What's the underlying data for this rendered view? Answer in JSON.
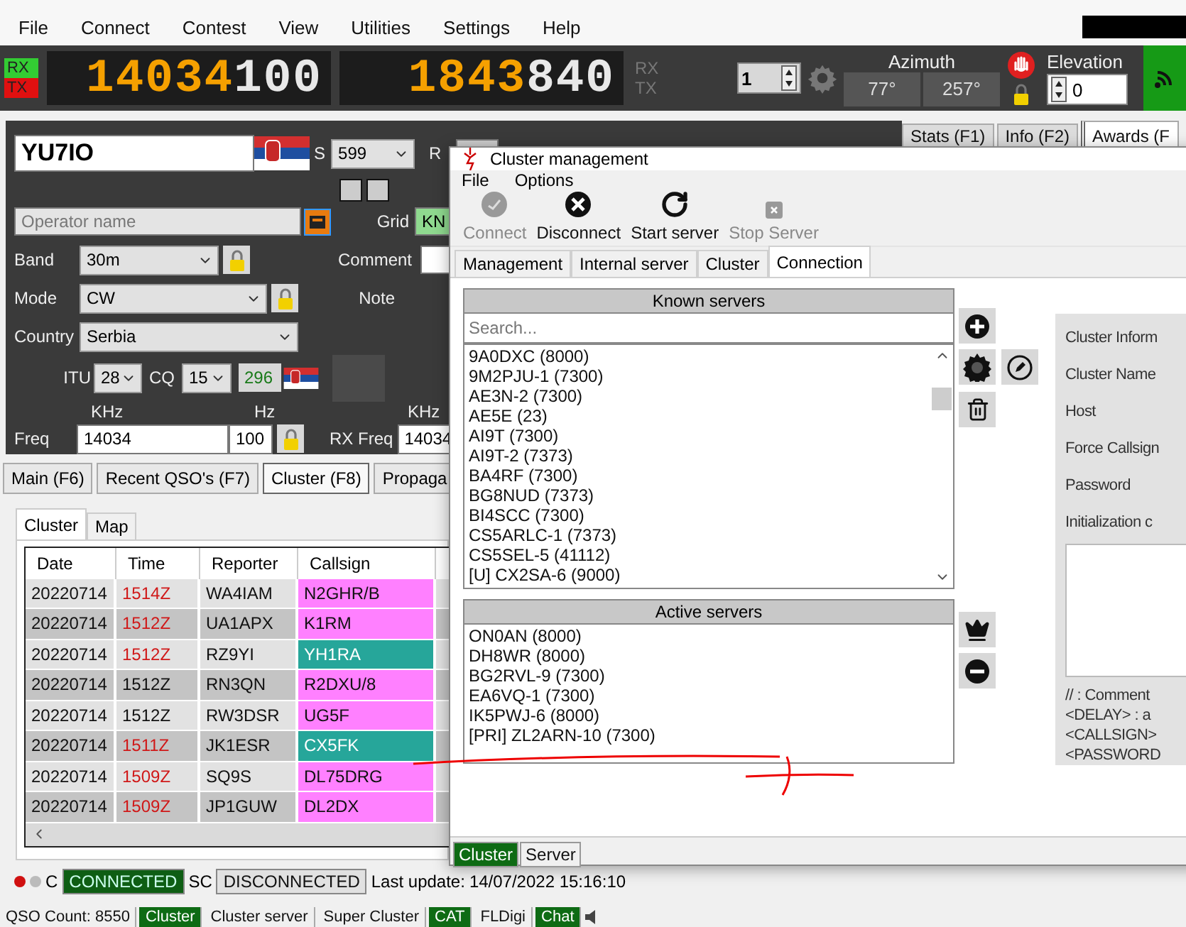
{
  "menu": [
    "File",
    "Connect",
    "Contest",
    "View",
    "Utilities",
    "Settings",
    "Help"
  ],
  "vfo": {
    "rx": "RX",
    "tx": "TX",
    "freq_main": "14034",
    "freq_sub": "100",
    "freq2_main": "1843",
    "freq2_sub": "840",
    "side_rx": "RX",
    "side_tx": "TX"
  },
  "rotator": {
    "spin": "1",
    "azimuth_label": "Azimuth",
    "azimuth_values": [
      "77°",
      "257°"
    ],
    "elevation_label": "Elevation",
    "elevation": "0"
  },
  "side_tabs": [
    {
      "label": "Stats (F1)",
      "selected": false
    },
    {
      "label": "Info (F2)",
      "selected": false
    },
    {
      "label": "Awards (F",
      "selected": true
    }
  ],
  "entry": {
    "callsign": "YU7IO",
    "s_label": "S",
    "rst_sent": "599",
    "r_label": "R",
    "operator_placeholder": "Operator name",
    "grid_label": "Grid",
    "grid": "KN",
    "band_label": "Band",
    "band": "30m",
    "comment_label": "Comment",
    "mode_label": "Mode",
    "mode": "CW",
    "note_label": "Note",
    "country_label": "Country",
    "country": "Serbia",
    "itu_label": "ITU",
    "itu": "28",
    "cq_label": "CQ",
    "cq": "15",
    "dxcc": "296",
    "khz_label": "KHz",
    "hz_label": "Hz",
    "rx_khz_label": "KHz",
    "freq_label": "Freq",
    "freq_khz": "14034",
    "freq_hz": "100",
    "rx_freq_label": "RX Freq",
    "rx_freq": "14034"
  },
  "main_tabs": [
    {
      "label": "Main (F6)",
      "selected": false
    },
    {
      "label": "Recent QSO's (F7)",
      "selected": false
    },
    {
      "label": "Cluster (F8)",
      "selected": true
    },
    {
      "label": "Propaga",
      "selected": false
    }
  ],
  "inner_tabs": [
    {
      "label": "Cluster",
      "selected": true
    },
    {
      "label": "Map",
      "selected": false
    }
  ],
  "table": {
    "columns": [
      "Date",
      "Time",
      "Reporter",
      "Callsign"
    ],
    "rows": [
      {
        "date": "20220714",
        "time": "1514Z",
        "recent": true,
        "reporter": "WA4IAM",
        "callsign": "N2GHR/B",
        "color": "#ff80ff"
      },
      {
        "date": "20220714",
        "time": "1512Z",
        "recent": true,
        "reporter": "UA1APX",
        "callsign": "K1RM",
        "color": "#ff80ff"
      },
      {
        "date": "20220714",
        "time": "1512Z",
        "recent": true,
        "reporter": "RZ9YI",
        "callsign": "YH1RA",
        "color": "#26a69a"
      },
      {
        "date": "20220714",
        "time": "1512Z",
        "recent": false,
        "reporter": "RN3QN",
        "callsign": "R2DXU/8",
        "color": "#ff80ff"
      },
      {
        "date": "20220714",
        "time": "1512Z",
        "recent": false,
        "reporter": "RW3DSR",
        "callsign": "UG5F",
        "color": "#ff80ff"
      },
      {
        "date": "20220714",
        "time": "1511Z",
        "recent": true,
        "reporter": "JK1ESR",
        "callsign": "CX5FK",
        "color": "#26a69a"
      },
      {
        "date": "20220714",
        "time": "1509Z",
        "recent": true,
        "reporter": "SQ9S",
        "callsign": "DL75DRG",
        "color": "#ff80ff"
      },
      {
        "date": "20220714",
        "time": "1509Z",
        "recent": true,
        "reporter": "JP1GUW",
        "callsign": "DL2DX",
        "color": "#ff80ff"
      }
    ]
  },
  "status": {
    "c_label": "C",
    "c_status": "CONNECTED",
    "c_connected": true,
    "sc_label": "SC",
    "sc_status": "DISCONNECTED",
    "sc_connected": false,
    "last_update_label": "Last update:",
    "last_update": "14/07/2022 15:16:10"
  },
  "bottom_bar": [
    {
      "label": "QSO Count: 8550",
      "active": false
    },
    {
      "label": "Cluster",
      "active": true
    },
    {
      "label": "Cluster server",
      "active": false
    },
    {
      "label": "Super Cluster",
      "active": false
    },
    {
      "label": "CAT",
      "active": true
    },
    {
      "label": "FLDigi",
      "active": false
    },
    {
      "label": "Chat",
      "active": true
    }
  ],
  "dialog": {
    "title": "Cluster management",
    "menu": [
      "File",
      "Options"
    ],
    "toolbar": [
      {
        "kind": "connect",
        "label": "Connect",
        "disabled": true
      },
      {
        "kind": "disconnect",
        "label": "Disconnect",
        "disabled": false
      },
      {
        "kind": "start",
        "label": "Start server",
        "disabled": false
      },
      {
        "kind": "stop",
        "label": "Stop Server",
        "disabled": true
      }
    ],
    "tabs": [
      {
        "label": "Management",
        "selected": false
      },
      {
        "label": "Internal server",
        "selected": false
      },
      {
        "label": "Cluster",
        "selected": false
      },
      {
        "label": "Connection",
        "selected": true
      }
    ],
    "known_title": "Known servers",
    "search_placeholder": "Search...",
    "known": [
      "9A0DXC (8000)",
      "9M2PJU-1 (7300)",
      "AE3N-2 (7300)",
      "AE5E (23)",
      "AI9T (7300)",
      "AI9T-2 (7373)",
      "BA4RF (7300)",
      "BG8NUD (7373)",
      "BI4SCC (7300)",
      "CS5ARLC-1 (7373)",
      "CS5SEL-5 (41112)",
      "[U] CX2SA-6 (9000)"
    ],
    "active_title": "Active servers",
    "active": [
      "ON0AN (8000)",
      "DH8WR (8000)",
      "BG2RVL-9 (7300)",
      "EA6VQ-1 (7300)",
      "IK5PWJ-6 (8000)",
      "[PRI] ZL2ARN-10 (7300)"
    ],
    "info_labels": [
      "Cluster Inform",
      "Cluster Name",
      "Host",
      "Force Callsign",
      "Password",
      "Initialization c"
    ],
    "info_hints": [
      "// : Comment",
      "<DELAY> : a",
      "<CALLSIGN>",
      "<PASSWORD"
    ],
    "bottom_tabs": [
      {
        "label": "Cluster",
        "selected": true
      },
      {
        "label": "Server",
        "selected": false
      }
    ]
  }
}
